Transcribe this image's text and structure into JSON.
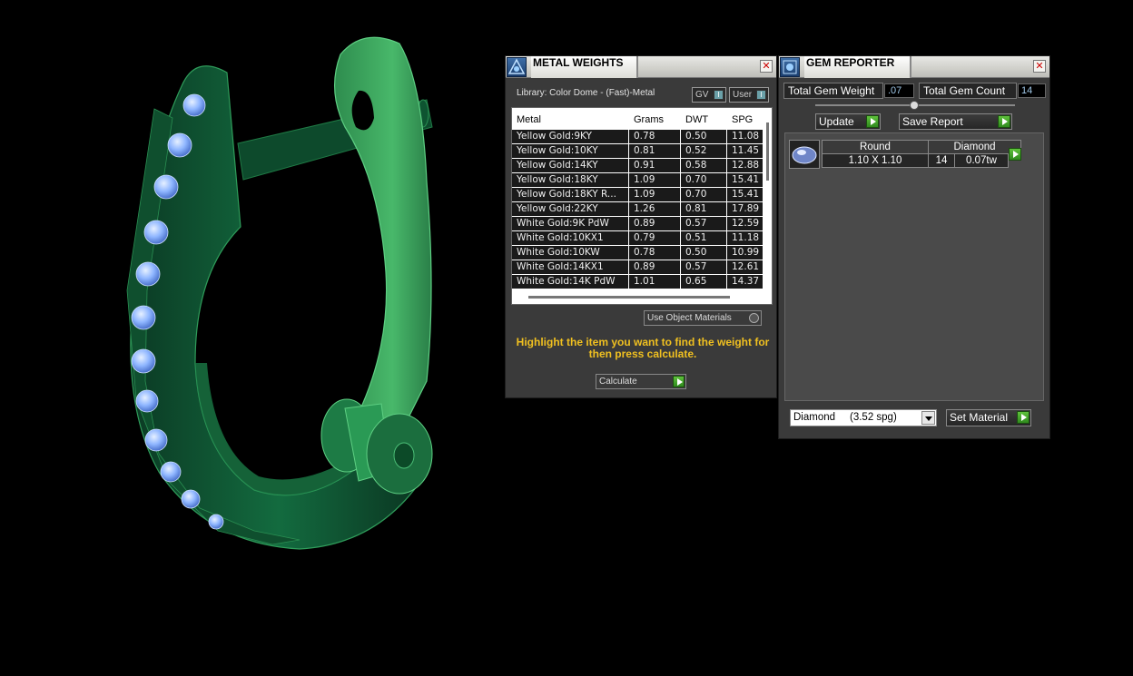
{
  "metal_panel": {
    "title": "METAL WEIGHTS",
    "library": "Library: Color Dome - (Fast)-Metal",
    "gv_label": "GV",
    "user_label": "User",
    "columns": [
      "Metal",
      "Grams",
      "DWT",
      "SPG"
    ],
    "rows": [
      [
        "Yellow Gold:9KY",
        "0.78",
        "0.50",
        "11.08"
      ],
      [
        "Yellow Gold:10KY",
        "0.81",
        "0.52",
        "11.45"
      ],
      [
        "Yellow Gold:14KY",
        "0.91",
        "0.58",
        "12.88"
      ],
      [
        "Yellow Gold:18KY",
        "1.09",
        "0.70",
        "15.41"
      ],
      [
        "Yellow Gold:18KY R...",
        "1.09",
        "0.70",
        "15.41"
      ],
      [
        "Yellow Gold:22KY",
        "1.26",
        "0.81",
        "17.89"
      ],
      [
        "White Gold:9K PdW",
        "0.89",
        "0.57",
        "12.59"
      ],
      [
        "White Gold:10KX1",
        "0.79",
        "0.51",
        "11.18"
      ],
      [
        "White Gold:10KW",
        "0.78",
        "0.50",
        "10.99"
      ],
      [
        "White Gold:14KX1",
        "0.89",
        "0.57",
        "12.61"
      ],
      [
        "White Gold:14K PdW",
        "1.01",
        "0.65",
        "14.37"
      ]
    ],
    "use_object_materials": "Use Object Materials",
    "hint": "Highlight the item you want to find the weight for then press calculate.",
    "calculate_label": "Calculate"
  },
  "gem_panel": {
    "title": "GEM REPORTER",
    "total_weight_label": "Total Gem Weight",
    "total_weight_value": ".07",
    "total_count_label": "Total Gem Count",
    "total_count_value": "14",
    "update_label": "Update",
    "save_report_label": "Save Report",
    "gem": {
      "shape": "Round",
      "material": "Diamond",
      "size": "1.10 X 1.10",
      "count": "14",
      "weight": "0.07tw"
    },
    "material_select": "Diamond     (3.52 spg)",
    "set_material_label": "Set Material"
  },
  "colors": {
    "panel_bg": "#3a3a3a",
    "hint_text": "#f0c020",
    "ring_green": "#2fa35a",
    "gem_blue": "#8fb6ff"
  }
}
